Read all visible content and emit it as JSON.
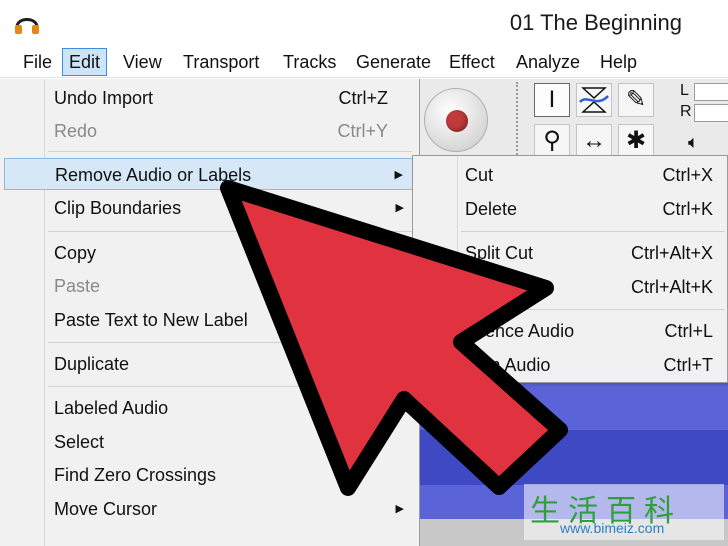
{
  "window": {
    "title": "01 The Beginning",
    "app_icon": "headphones-icon"
  },
  "menubar": {
    "items": [
      {
        "label": "File"
      },
      {
        "label": "Edit"
      },
      {
        "label": "View"
      },
      {
        "label": "Transport"
      },
      {
        "label": "Tracks"
      },
      {
        "label": "Generate"
      },
      {
        "label": "Effect"
      },
      {
        "label": "Analyze"
      },
      {
        "label": "Help"
      }
    ],
    "active": "Edit"
  },
  "edit_menu": {
    "items": [
      {
        "label": "Undo Import",
        "shortcut": "Ctrl+Z"
      },
      {
        "label": "Redo",
        "shortcut": "Ctrl+Y"
      },
      {
        "label": "Remove Audio or Labels"
      },
      {
        "label": "Clip Boundaries"
      },
      {
        "label": "Copy"
      },
      {
        "label": "Paste"
      },
      {
        "label": "Paste Text to New Label"
      },
      {
        "label": "Duplicate"
      },
      {
        "label": "Labeled Audio"
      },
      {
        "label": "Select"
      },
      {
        "label": "Find Zero Crossings"
      },
      {
        "label": "Move Cursor"
      }
    ]
  },
  "submenu": {
    "items": [
      {
        "label": "Cut",
        "shortcut": "Ctrl+X"
      },
      {
        "label": "Delete",
        "shortcut": "Ctrl+K"
      },
      {
        "label": "Split Cut",
        "shortcut": "Ctrl+Alt+X"
      },
      {
        "label": "",
        "shortcut": "Ctrl+Alt+K"
      },
      {
        "label": "Silence Audio",
        "shortcut": "Ctrl+L"
      },
      {
        "label": "Trim Audio",
        "shortcut": "Ctrl+T"
      }
    ]
  },
  "toolbar": {
    "record": "record-icon",
    "tools": [
      "selection-tool-icon",
      "envelope-tool-icon",
      "draw-tool-icon",
      "zoom-tool-icon",
      "timeshift-tool-icon",
      "multi-tool-icon"
    ],
    "meter_left": "L",
    "meter_right": "R",
    "volume_icon": "speaker-icon"
  },
  "watermark": {
    "chars": "生活百科",
    "url": "www.bimeiz.com"
  },
  "colors": {
    "menu_highlight": "#cce4f7",
    "item_highlight": "#d6e8f8",
    "arrow_fill": "#e0323f",
    "arrow_stroke": "#000000",
    "waveform": "#5a63d8",
    "record_dot": "#c0393b"
  }
}
